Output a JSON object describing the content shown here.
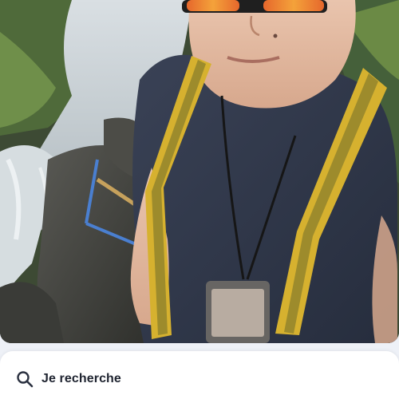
{
  "profile": {
    "photo_icon": "profile-photo",
    "search": {
      "icon": "search-icon",
      "label": "Je recherche"
    }
  },
  "colors": {
    "card_background": "#ffffff",
    "screen_background": "#eef1f7",
    "text_primary": "#1f2430"
  }
}
